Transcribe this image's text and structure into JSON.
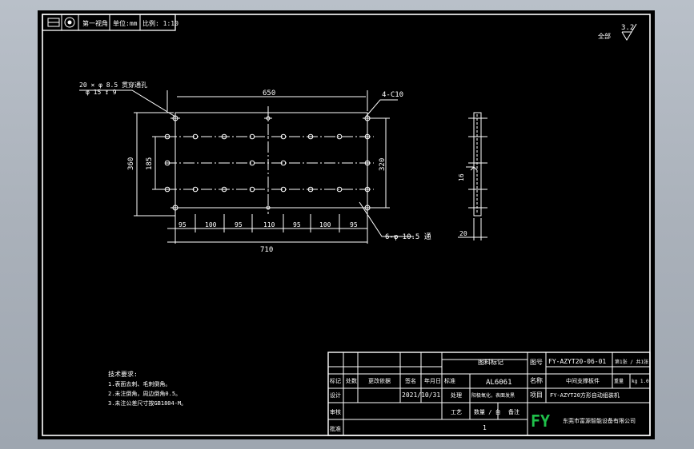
{
  "header": {
    "view_label": "第一视角",
    "unit_label": "单位:mm",
    "scale_label": "比例: 1:10"
  },
  "roughness": {
    "rest_label": "全部",
    "value": "3.2"
  },
  "part": {
    "counterbore_note": "20 × φ 8.5 贯穿通孔",
    "counterbore_depth": "φ 15 ↧ 9",
    "corner_note": "4-C10",
    "hole_note": "6-φ 10.5 通",
    "dims": {
      "length": "650",
      "overall_length": "710",
      "height": "360",
      "inner_height": "185",
      "hole_span": "320",
      "thickness": "20",
      "side_depth": "16"
    },
    "spacing": [
      "95",
      "100",
      "95",
      "110",
      "95",
      "100",
      "95"
    ]
  },
  "tech_req": {
    "title": "技术要求:",
    "items": [
      "1.表面去刺、毛刺倒角。",
      "2.未注倒角，周边倒角0.5。",
      "3.未注公差尺寸按GB1804-M。"
    ]
  },
  "title_block": {
    "material_header": "图料标记",
    "material": "AL6061",
    "drawing_no_label": "图号",
    "drawing_no": "FY-AZYT20-06-01",
    "sheet_label": "第1张 / 共1张",
    "part_name_label": "名称",
    "part_name": "中间支撑板件",
    "weight_label": "重量",
    "weight": "kg 1.0",
    "project_label": "项目",
    "project": "FY-AZYT20方形自动组装机",
    "heat_label": "处理",
    "heat": "阳极氧化，表面发黑",
    "date": "2021/10/31",
    "qty_label": "数量 / 台",
    "qty": "1",
    "remark_label": "备注",
    "company": "东莞市富源智能设备有限公司",
    "logo": "FY",
    "row_labels": [
      "标记",
      "处数",
      "更改依据",
      "签名",
      "年月日"
    ],
    "left_labels": [
      "设计",
      "审核",
      "批准"
    ],
    "standard_label": "标准",
    "process_label": "工艺"
  }
}
